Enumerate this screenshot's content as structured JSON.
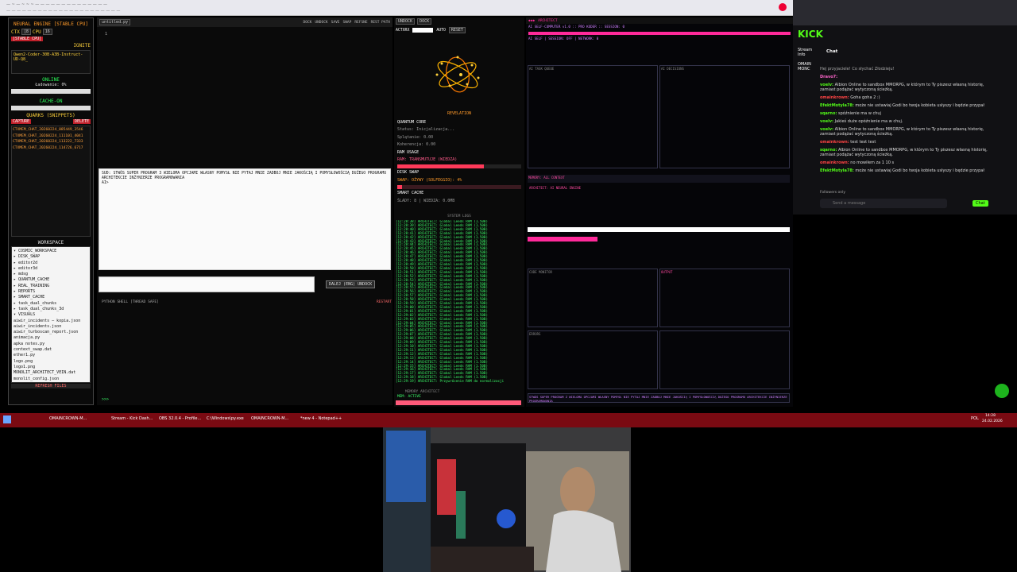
{
  "left_panel": {
    "title": "NEURAL ENGINE [STABLE CPU]",
    "ctx_label": "CTX",
    "ctx_value": "[8",
    "cpu_label": "CPU",
    "cpu_value": "16",
    "stable_label": "[STABLE CPU]",
    "ignite_label": "IGNITE",
    "model": "Qwen2-Coder-30B-A3B-Instruct-UD-Q8_",
    "status": "ONLINE",
    "loading": "Ładowanie: 0%",
    "cache": "CACHE-ON",
    "quarks_title": "QUARKS (SNIPPETS)",
    "capture_label": "CAPTURE",
    "delete_label": "DELETE",
    "snippets": [
      "CTXMEM_CHAT_20260224_085449_3546",
      "CTXMEM_CHAT_20260224_111101_4041",
      "CTXMEM_CHAT_20260224_113222_7333",
      "CTXMEM_CHAT_20260224_114726_6717"
    ],
    "workspace_title": "WORKSPACE",
    "tree": [
      "▾ COSMIC_WORKSPACE",
      "  ▸ DISK_SWAP",
      "  ▸ editor2d",
      "  ▸ editor3d",
      "  ▸ mdsg",
      "  ▸ QUANTUM_CACHE",
      "  ▸ REAL_TRAINING",
      "  ▸ REPORTS",
      "  ▸ SMART_CACHE",
      "  ▸ task_dual_chunks",
      "  ▸ task_dual_chunks_3d",
      "  ▾ VISUALS",
      "     aiwir_incidents — kopia.json",
      "     aiwir_incidents.json",
      "     aiwir_turboscan_report.json",
      "     animacja.py",
      "     apka notes.py",
      "     context_swap.dat",
      "     ether1.py",
      "     logo.png",
      "     logo1.png",
      "     MONOLIT_ARCHITECT_VEIN.dat",
      "     monolit_config.json"
    ],
    "refresh_label": "REFRESH FILES"
  },
  "editor": {
    "tab": "untitled.py",
    "toolbar": [
      "DOCK",
      "UNDOCK",
      "SAVE",
      "SWAP",
      "REFSNE",
      "REST PATH"
    ],
    "line_number": "1",
    "prompt_text": "SUD: STWÓS SUPER PROGRAM 3 WIELOMA OPCJAMI WŁASNY POMYSŁ NIE PYTAJ MNIE ZADBOJ MNIE JAKOŚCIĄ I POMYSŁOWOŚCIĄ DUŻEGO PROGRAMU ARCHITEKCIE INŻYNIERZE PROGRAMOWANIA",
    "prompt_cursor": "AI>",
    "send_label": "DALEJ (ENG) UNDOCK",
    "shell_title": "PYTHON SHELL [THREAD SAFE]",
    "shell_prompt": ">>>",
    "restart_label": "RESTART"
  },
  "middle": {
    "undock_label": "UNDOCK",
    "dock_label": "DOCK",
    "actxrx_label": "ACTXRX",
    "auto_label": "AUTO",
    "reset_label": "RESET",
    "revelation": "REVELATION",
    "quantum_title": "QUANTUM CORE",
    "status": "Status: Inicjalizacja...",
    "spl": "Splątanie: 0.00",
    "koh": "Koherencja: 0.00",
    "ram_title": "RAM USAGE",
    "ram_label": "RAM: TRANSMUTUJE (WIEDZA)",
    "ram_fill": 0.7,
    "disk_title": "DISK SWAP",
    "disk_label": "SWAP: OŻYWY (SOLFEGGIO): 4%",
    "disk_fill": 0.04,
    "smart_title": "SMART CACHE",
    "smart_label": "ŚLADY: 8 | WIEDZA: 0.0MB",
    "syslog_title": "SYSTEM LOGS",
    "mem_label": "MEMORY ARCHITECT",
    "mem_status": "MEM: ACTIVE",
    "log_lines": [
      "[12:28:38] ARCHITECT: Global Leeds RAM (1.50B)",
      "[12:28:39] ARCHITECT: Global Leeds RAM (1.50B)",
      "[12:28:40] ARCHITECT: Global Leeds RAM (1.50B)",
      "[12:28:41] ARCHITECT: Global Leeds RAM (1.50B)",
      "[12:28:42] ARCHITECT: Global Leeds RAM (1.50B)",
      "[12:28:43] ARCHITECT: Global Leeds RAM (1.50B)",
      "[12:28:44] ARCHITECT: Global Leeds RAM (1.50B)",
      "[12:28:45] ARCHITECT: Global Leeds RAM (1.50B)",
      "[12:28:46] ARCHITECT: Global Leeds RAM (1.50B)",
      "[12:28:47] ARCHITECT: Global Leeds RAM (1.50B)",
      "[12:28:48] ARCHITECT: Global Leeds RAM (1.50B)",
      "[12:28:49] ARCHITECT: Global Leeds RAM (1.50B)",
      "[12:28:50] ARCHITECT: Global Leeds RAM (1.50B)",
      "[12:28:51] ARCHITECT: Global Leeds RAM (1.50B)",
      "[12:28:52] ARCHITECT: Global Leeds RAM (1.50B)",
      "[12:28:53] ARCHITECT: Global Leeds RAM (1.50B)",
      "[12:28:54] ARCHITECT: Global Leeds RAM (1.50B)",
      "[12:28:55] ARCHITECT: Global Leeds RAM (1.50B)",
      "[12:28:56] ARCHITECT: Global Leeds RAM (1.50B)",
      "[12:28:57] ARCHITECT: Global Leeds RAM (1.50B)",
      "[12:28:58] ARCHITECT: Global Leeds RAM (1.50B)",
      "[12:28:59] ARCHITECT: Global Leeds RAM (1.50B)",
      "[12:29:00] ARCHITECT: Global Leeds RAM (1.50B)",
      "[12:29:01] ARCHITECT: Global Leeds RAM (1.50B)",
      "[12:29:02] ARCHITECT: Global Leeds RAM (1.50B)",
      "[12:29:03] ARCHITECT: Global Leeds RAM (1.50B)",
      "[12:29:04] ARCHITECT: Global Leeds RAM (1.50B)",
      "[12:29:05] ARCHITECT: Global Leeds RAM (1.50B)",
      "[12:29:06] ARCHITECT: Global Leeds RAM (1.50B)",
      "[12:29:07] ARCHITECT: Global Leeds RAM (1.50B)",
      "[12:29:08] ARCHITECT: Global Leeds RAM (1.50B)",
      "[12:29:09] ARCHITECT: Global Leeds RAM (1.50B)",
      "[12:29:10] ARCHITECT: Global Leeds RAM (1.50B)",
      "[12:29:11] ARCHITECT: Global Leeds RAM (1.50B)",
      "[12:29:12] ARCHITECT: Global Leeds RAM (1.50B)",
      "[12:29:13] ARCHITECT: Global Leeds RAM (1.50B)",
      "[12:29:14] ARCHITECT: Global Leeds RAM (1.50B)",
      "[12:29:15] ARCHITECT: Global Leeds RAM (1.50B)",
      "[12:29:16] ARCHITECT: Global Leeds RAM (1.50B)",
      "[12:29:17] ARCHITECT: Global Leeds RAM (1.50B)",
      "[12:29:18] ARCHITECT: Global Leeds RAM (1.50B)",
      "[12:29:19] ARCHITECT: Przywrócenie RAM do normalizacji"
    ]
  },
  "right_panel": {
    "title": "ARCHITECT",
    "header1": "AI SELF-COMPUTER v1.0 :: PRO KODER :: SESSION: 0",
    "bar1": "AI SELF | SESSION: OFF | NETWORK: 0",
    "pane_a": "AI TASK QUEUE",
    "pane_b": "AI DECISIONS",
    "bar2": "MEMORY: ALL CONTEXT",
    "bar3": "ARCHITECT: AI NEURAL ENGINE",
    "pane_c": "CODE MONITOR",
    "pane_d": "OUTPUT",
    "pane_e": "ERRORS",
    "footer": "STWÓS SUPER PROGRAM Z WIELOMA OPCJAMI WŁASNY POMYSŁ NIE PYTAJ MNIE ZADBOJ MNIE JAKOŚCIĄ I POMYSŁOWOŚCIĄ DUŻEGO PROGRAMU ARCHITEKCIE INŻYNIERZE PROGRAMOWANIA"
  },
  "browser": {
    "brand": "KICK",
    "stream_info": "Stream Info",
    "chat_title": "Chat",
    "user_label": "OMAIN MONC",
    "pinned": "Hej przyjaciele! Co słychać Złodzieju!",
    "messages": [
      {
        "user": "Dravo7:",
        "text": ""
      },
      {
        "user": "voelv:",
        "text": "Albion Online to sandbox MMORPG, w którym to Ty piszesz własną historię, zamiast podążać wytyczoną ścieżką."
      },
      {
        "user": "omainkrown:",
        "text": "Goha goha 2 :)"
      },
      {
        "user": "EfektMotyla78:",
        "text": "może nie ustawiaj Godi bo twoja kobieta usłyszy i będzie przypał"
      },
      {
        "user": "sqarno:",
        "text": "spóźnienie ma w chuj"
      },
      {
        "user": "voelv:",
        "text": "Jakieś duże opóźnienie ma w chuj."
      },
      {
        "user": "voelv:",
        "text": "Albion Online to sandbox MMORPG, w którym to Ty piszesz własną historię, zamiast podążać wytyczoną ścieżką."
      },
      {
        "user": "omainkrown:",
        "text": "test test test"
      },
      {
        "user": "sqarno:",
        "text": "Albion Online to sandbox MMORPG, w którym to Ty piszesz własną historię, zamiast podążać wytyczoną ścieżką."
      },
      {
        "user": "omainkrown:",
        "text": "no mowiłem za 1 10 s"
      },
      {
        "user": "EfektMotyla78:",
        "text": "może nie ustawiaj Godi bo twoja kobieta usłyszy i będzie przypał"
      }
    ],
    "followers": "Followers only",
    "send_placeholder": "Send a message",
    "chat_btn": "Chat"
  },
  "taskbar": {
    "items": [
      "OMAINCROWN-M...",
      "Stream - Kick Dash...",
      "OBS 32.0.4 - Profile...",
      "C:\\Windows\\py.exe",
      "OMAINCROWN-M...",
      "*new 4 - Notepad++"
    ],
    "lang": "POL",
    "time": "14:28",
    "date": "24.02.2026"
  },
  "colors": {
    "accent_orange": "#ff9a2a",
    "accent_green": "#2bff5a",
    "accent_pink": "#ff2a9a",
    "taskbar": "#7a0a12",
    "kick_green": "#53fc18"
  }
}
